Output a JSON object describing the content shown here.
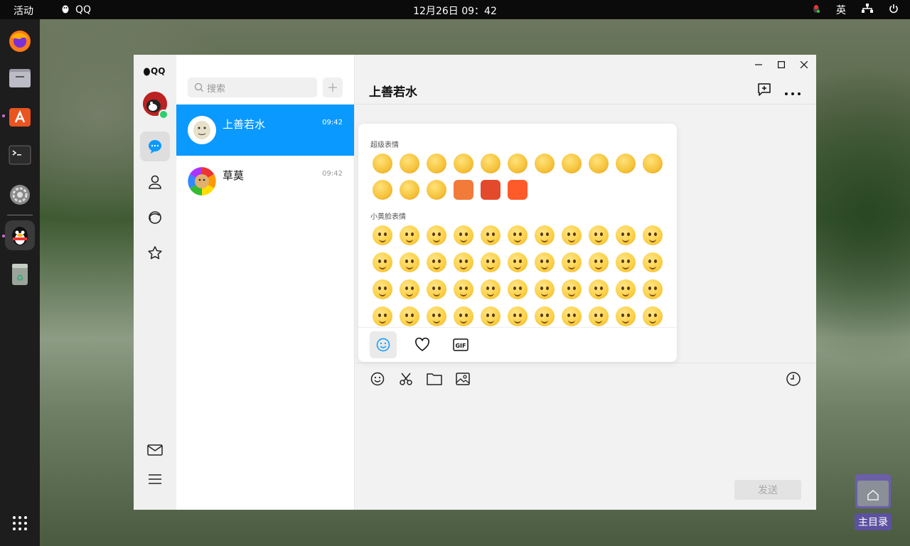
{
  "topbar": {
    "activities": "活动",
    "app_name": "QQ",
    "clock": "12月26日  09：42",
    "input_method": "英"
  },
  "dock": {
    "items": [
      "firefox-icon",
      "files-icon",
      "app-center-icon",
      "terminal-icon",
      "settings-icon",
      "qq-icon",
      "trash-icon",
      "app-grid-icon"
    ]
  },
  "qq": {
    "logo": "QQ",
    "search": {
      "placeholder": "搜索"
    },
    "conversations": [
      {
        "name": "上善若水",
        "time": "09:42"
      },
      {
        "name": "草莫",
        "time": "09:42"
      }
    ],
    "chat": {
      "title": "上善若水"
    },
    "send_label": "发送",
    "emoji_panel": {
      "section_super": "超级表情",
      "section_small": "小黄脸表情",
      "super_count": 17,
      "small_count": 44
    }
  },
  "desktop": {
    "home_folder_label": "主目录"
  },
  "colors": {
    "accent": "#0a99ff",
    "topbar": "#0b0b0b",
    "dock": "#1d1d1d"
  }
}
